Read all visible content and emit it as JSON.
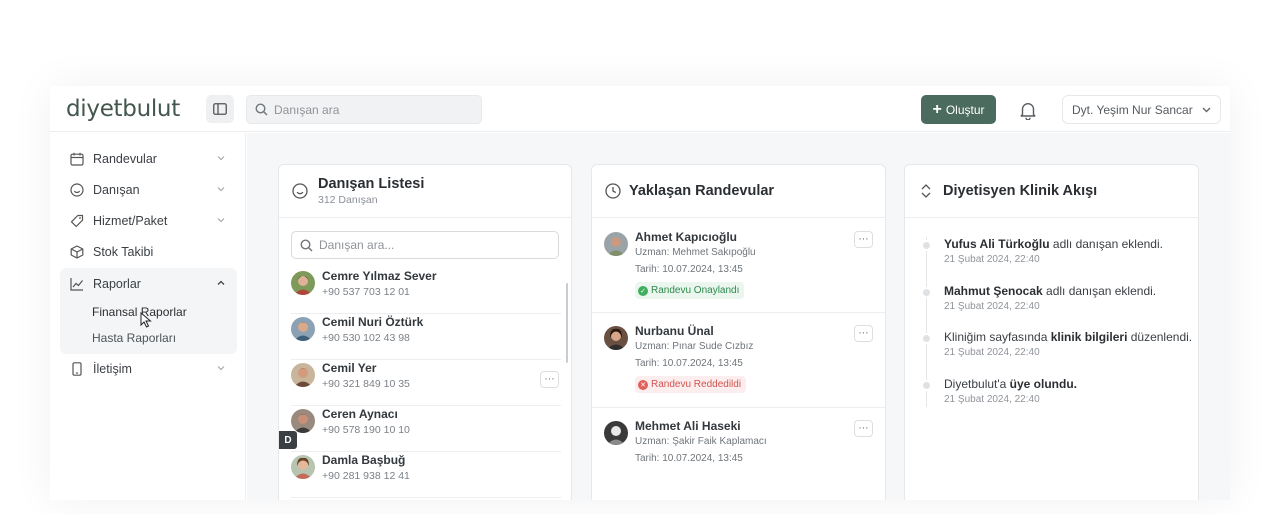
{
  "header": {
    "logo": "diyetbulut",
    "search_placeholder": "Danışan ara",
    "create_label": "Oluştur",
    "user_label": "Dyt. Yeşim Nur Sancar",
    "icons": [
      "sidebar-toggle-icon",
      "search-icon",
      "plus-icon",
      "bell-icon",
      "chevron-down-icon"
    ]
  },
  "sidebar": {
    "items": [
      {
        "label": "Randevular",
        "icon": "calendar-icon"
      },
      {
        "label": "Danışan",
        "icon": "smile-icon"
      },
      {
        "label": "Hizmet/Paket",
        "icon": "tag-icon"
      },
      {
        "label": "Stok Takibi",
        "icon": "box-icon"
      },
      {
        "label": "Raporlar",
        "icon": "chart-icon"
      },
      {
        "label": "İletişim",
        "icon": "phone-icon"
      }
    ],
    "report_subitems": [
      "Finansal Raporlar",
      "Hasta Raporları"
    ]
  },
  "clients_card": {
    "title": "Danışan Listesi",
    "count": "312 Danışan",
    "search_placeholder": "Danışan ara...",
    "section_letter": "D",
    "clients": [
      {
        "name": "Cemre Yılmaz Sever",
        "phone": "+90 537 703 12 01"
      },
      {
        "name": "Cemil Nuri Öztürk",
        "phone": "+90 530 102 43 98"
      },
      {
        "name": "Cemil Yer",
        "phone": "+90 321 849 10 35"
      },
      {
        "name": "Ceren Aynacı",
        "phone": "+90 578 190 10 10"
      },
      {
        "name": "Damla Başbuğ",
        "phone": "+90 281 938 12 41"
      }
    ]
  },
  "appointments_card": {
    "title": "Yaklaşan Randevular",
    "items": [
      {
        "name": "Ahmet Kapıcıoğlu",
        "expert": "Uzman: Mehmet Sakıpoğlu",
        "date": "Tarih: 10.07.2024, 13:45",
        "status": "Randevu Onaylandı",
        "status_type": "approved"
      },
      {
        "name": "Nurbanu Ünal",
        "expert": "Uzman: Pınar Sude Cızbız",
        "date": "Tarih: 10.07.2024, 13:45",
        "status": "Randevu Reddedildi",
        "status_type": "rejected"
      },
      {
        "name": "Mehmet Ali Haseki",
        "expert": "Uzman: Şakir Faik Kaplamacı",
        "date": "Tarih: 10.07.2024, 13:45",
        "status": "",
        "status_type": "none"
      }
    ],
    "colors": {
      "approved": "#2d8a4b",
      "rejected": "#d2534f"
    }
  },
  "feed_card": {
    "title": "Diyetisyen Klinik Akışı",
    "items": [
      {
        "bold": "Yufus Ali Türkoğlu",
        "text": " adlı danışan eklendi.",
        "time": "21 Şubat 2024, 22:40"
      },
      {
        "bold": "Mahmut Şenocak",
        "text": " adlı danışan eklendi.",
        "time": "21 Şubat 2024, 22:40"
      },
      {
        "pre": "Kliniğim sayfasında ",
        "bold": "klinik bilgileri",
        "text": " düzenlendi.",
        "time": "21 Şubat 2024, 22:40"
      },
      {
        "pre": "Diyetbulut'a ",
        "bold": "üye olundu.",
        "text": "",
        "time": "21 Şubat 2024, 22:40"
      }
    ]
  },
  "colors": {
    "brand": "#4b6b5f",
    "logo": "#44574e"
  }
}
